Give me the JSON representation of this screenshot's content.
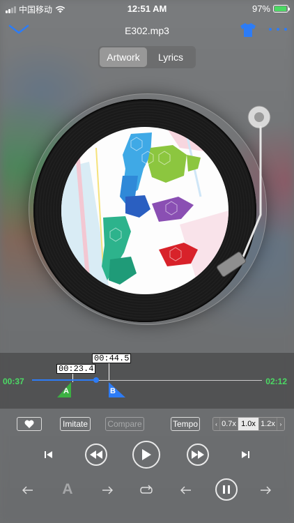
{
  "status_bar": {
    "carrier": "中国移动",
    "time": "12:51 AM",
    "battery": "97%",
    "battery_level": 0.97
  },
  "nav": {
    "title": "E302.mp3",
    "back_icon": "chevron-down-icon",
    "theme_icon": "tshirt-icon",
    "more_icon": "more-dots-icon"
  },
  "tabs": [
    {
      "label": "Artwork",
      "active": true
    },
    {
      "label": "Lyrics",
      "active": false
    }
  ],
  "player": {
    "elapsed": "00:37",
    "total": "02:12",
    "marker_a_time": "00:23.4",
    "marker_b_time": "00:44.5",
    "marker_a_label": "A",
    "marker_b_label": "B",
    "progress": 0.28
  },
  "actions": {
    "favorite_icon": "heart-icon",
    "imitate": "Imitate",
    "compare": "Compare",
    "tempo": "Tempo",
    "speeds": [
      "0.7x",
      "1.0x",
      "1.2x"
    ],
    "selected_speed": "1.0x"
  },
  "transport": {
    "icons": [
      "skip-previous-icon",
      "rewind-icon",
      "play-icon",
      "fast-forward-icon",
      "skip-next-icon"
    ]
  },
  "bottom_controls": {
    "a_label": "A",
    "icons": [
      "arrow-left-icon",
      "arrow-right-icon",
      "repeat-icon",
      "arrow-left-icon",
      "pause-icon",
      "arrow-right-icon"
    ]
  },
  "colors": {
    "accent": "#2d7cf6",
    "time_green": "#4cd964",
    "marker_a": "#3cb043",
    "marker_b": "#2d7cf6"
  }
}
